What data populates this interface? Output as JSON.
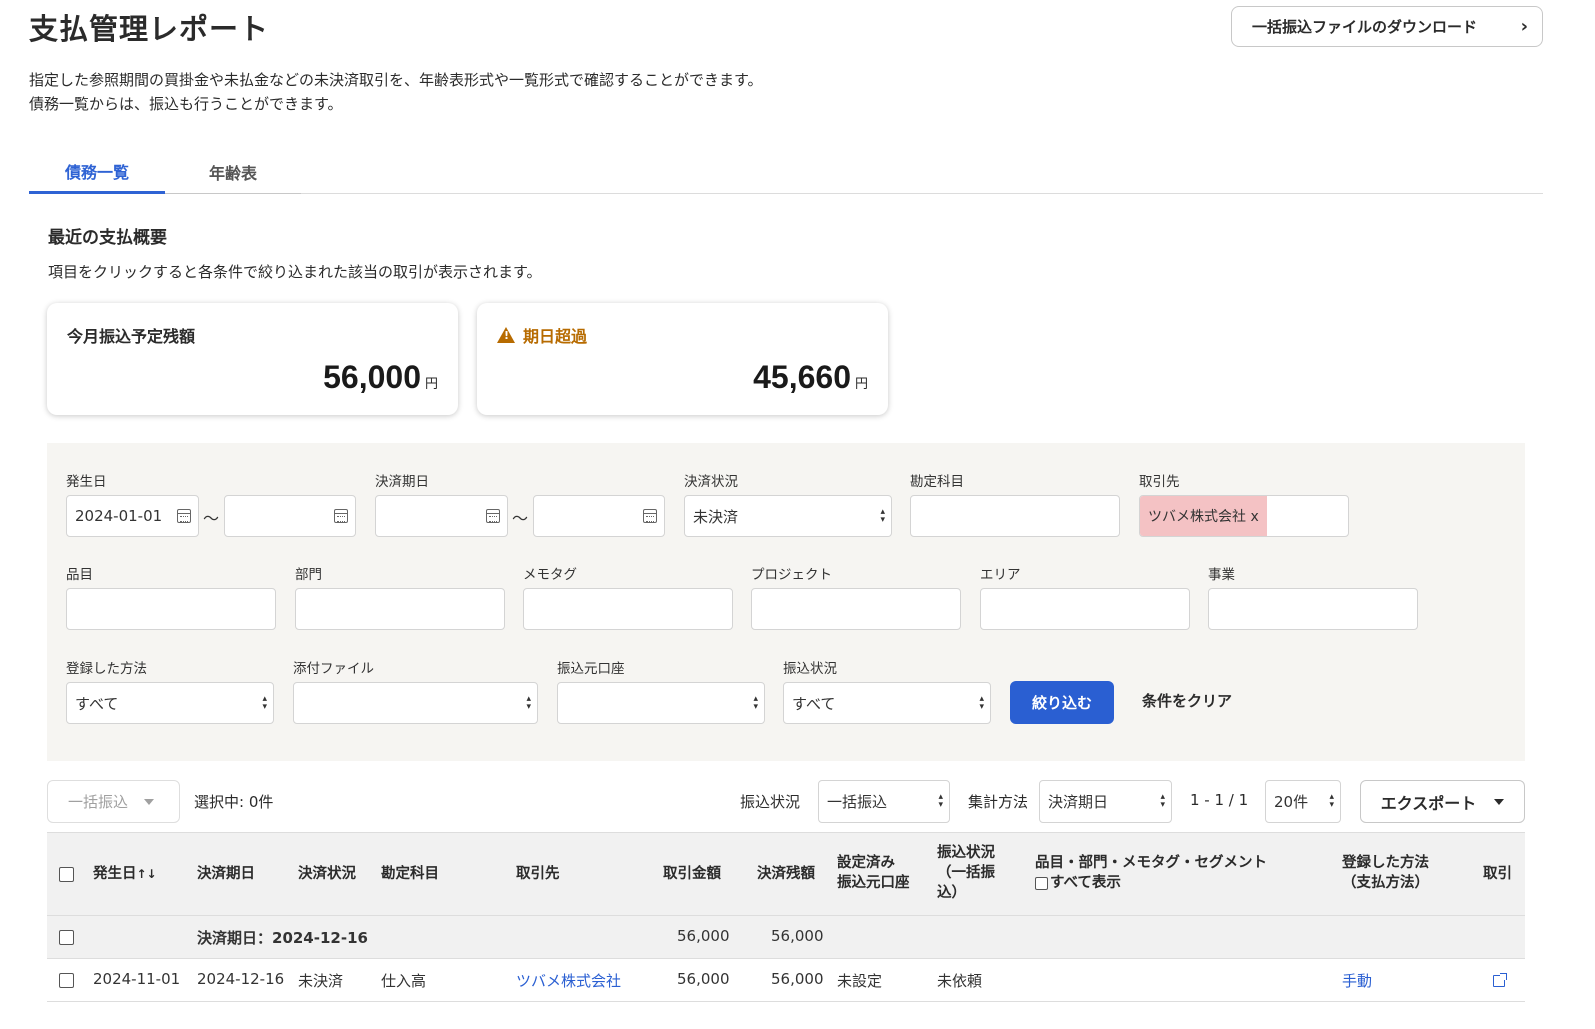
{
  "header": {
    "title": "支払管理レポート",
    "download_button": "一括振込ファイルのダウンロード",
    "description_line1": "指定した参照期間の買掛金や未払金などの未決済取引を、年齢表形式や一覧形式で確認することができます。",
    "description_line2": "債務一覧からは、振込も行うことができます。"
  },
  "tabs": [
    {
      "label": "債務一覧",
      "active": true
    },
    {
      "label": "年齢表",
      "active": false
    }
  ],
  "summary": {
    "title": "最近の支払概要",
    "description": "項目をクリックすると各条件で絞り込まれた該当の取引が表示されます。",
    "cards": [
      {
        "label": "今月振込予定残額",
        "value": "56,000",
        "unit": "円"
      },
      {
        "label": "期日超過",
        "value": "45,660",
        "unit": "円",
        "warning_color": "#b76b00"
      }
    ]
  },
  "filters": {
    "issue_date": {
      "label": "発生日",
      "from": "2024-01-01",
      "to": ""
    },
    "due_date": {
      "label": "決済期日",
      "from": "",
      "to": ""
    },
    "tilde": "〜",
    "settlement_status": {
      "label": "決済状況",
      "value": "未決済"
    },
    "account_item": {
      "label": "勘定科目",
      "value": ""
    },
    "partner": {
      "label": "取引先",
      "tag": "ツバメ株式会社 x"
    },
    "item": {
      "label": "品目"
    },
    "section": {
      "label": "部門"
    },
    "memo_tag": {
      "label": "メモタグ"
    },
    "project": {
      "label": "プロジェクト"
    },
    "area": {
      "label": "エリア"
    },
    "business": {
      "label": "事業"
    },
    "registration_method": {
      "label": "登録した方法",
      "value": "すべて"
    },
    "attachment": {
      "label": "添付ファイル",
      "value": ""
    },
    "source_account": {
      "label": "振込元口座",
      "value": ""
    },
    "transfer_status": {
      "label": "振込状況",
      "value": "すべて"
    },
    "apply_button": "絞り込む",
    "clear_button": "条件をクリア"
  },
  "toolbar": {
    "bulk_transfer": "一括振込",
    "selected": "選択中: 0件",
    "transfer_status_label": "振込状況",
    "transfer_status_value": "一括振込",
    "aggregate_label": "集計方法",
    "aggregate_value": "決済期日",
    "pagination": "1 - 1 / 1",
    "per_page": "20件",
    "export": "エクスポート"
  },
  "table": {
    "headers": {
      "issue_date": "発生日",
      "sort_icon": "↑↓",
      "due_date": "決済期日",
      "status": "決済状況",
      "account": "勘定科目",
      "partner": "取引先",
      "amount": "取引金額",
      "balance": "決済残額",
      "source_account_line1": "設定済み",
      "source_account_line2": "振込元口座",
      "transfer_line1": "振込状況",
      "transfer_line2": "（一括振",
      "transfer_line3": "込）",
      "tags_line1": "品目・部門・メモタグ・セグメント",
      "tags_line2": "すべて表示",
      "method_line1": "登録した方法",
      "method_line2": "（支払方法）",
      "deal": "取引"
    },
    "group": {
      "label": "決済期日：2024-12-16",
      "amount": "56,000",
      "balance": "56,000"
    },
    "rows": [
      {
        "issue_date": "2024-11-01",
        "due_date": "2024-12-16",
        "status": "未決済",
        "account": "仕入高",
        "partner": "ツバメ株式会社",
        "amount": "56,000",
        "balance": "56,000",
        "source_account": "未設定",
        "transfer": "未依頼",
        "method": "手動"
      }
    ]
  }
}
